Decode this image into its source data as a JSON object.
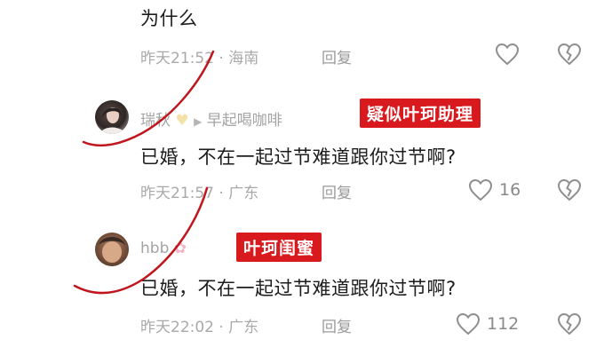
{
  "comments": [
    {
      "text": "为什么",
      "time": "昨天21:52",
      "location": "海南",
      "reply_label": "回复",
      "likes": ""
    },
    {
      "user": "瑞秋",
      "reply_target": "早起喝咖啡",
      "annotation": "疑似叶珂助理",
      "text": "已婚，不在一起过节难道跟你过节啊?",
      "time": "昨天21:57",
      "location": "广东",
      "reply_label": "回复",
      "likes": "16"
    },
    {
      "user": "hbb",
      "annotation": "叶珂闺蜜",
      "text": "已婚，不在一起过节难道跟你过节啊?",
      "time": "昨天22:02",
      "location": "广东",
      "reply_label": "回复",
      "likes": "112"
    }
  ],
  "separator": "·",
  "colors": {
    "annotation_bg": "#d8191d",
    "pen_mark": "#c0171f",
    "meta_gray": "#a9a9a9"
  }
}
